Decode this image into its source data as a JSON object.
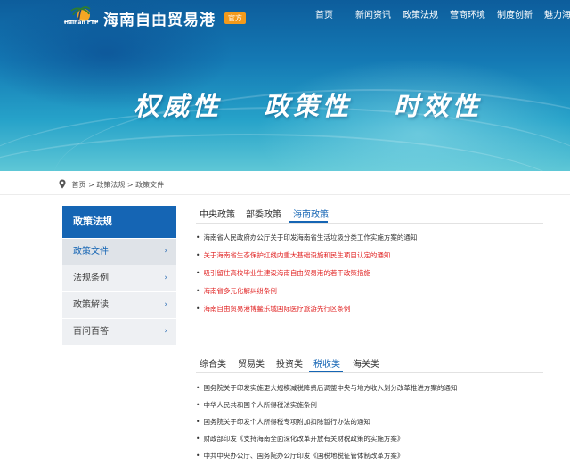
{
  "header": {
    "logo_text": "Hainan FTP",
    "site_title": "海南自由贸易港",
    "badge": "官方",
    "nav": [
      "首页",
      "新闻资讯",
      "政策法规",
      "营商环境",
      "制度创新",
      "魅力海南"
    ]
  },
  "hero": {
    "slogans": [
      "权威性",
      "政策性",
      "时效性"
    ]
  },
  "breadcrumb": [
    "首页",
    "政策法规",
    "政策文件"
  ],
  "breadcrumb_separator": ">",
  "sidebar": {
    "title": "政策法规",
    "items": [
      {
        "label": "政策文件",
        "active": true
      },
      {
        "label": "法规条例",
        "active": false
      },
      {
        "label": "政策解读",
        "active": false
      },
      {
        "label": "百问百答",
        "active": false
      }
    ]
  },
  "policy_tabs": {
    "tabs": [
      "中央政策",
      "部委政策",
      "海南政策"
    ],
    "active_index": 2,
    "items": [
      {
        "text": "海南省人民政府办公厅关于印发海南省生活垃圾分类工作实施方案的通知",
        "highlight": false
      },
      {
        "text": "关于海南省生态保护红线内重大基础设施和民生项目认定的通知",
        "highlight": true
      },
      {
        "text": "吸引留住高校毕业生建设海南自由贸易港的若干政策措施",
        "highlight": true
      },
      {
        "text": "海南省多元化解纠纷条例",
        "highlight": true
      },
      {
        "text": "海南自由贸易港博鳌乐城国际医疗旅游先行区条例",
        "highlight": true
      }
    ]
  },
  "category_tabs": {
    "tabs": [
      "综合类",
      "贸易类",
      "投资类",
      "税收类",
      "海关类"
    ],
    "active_index": 3,
    "items": [
      {
        "text": "国务院关于印发实施更大规模减税降费后调整中央与地方收入划分改革推进方案的通知",
        "highlight": false
      },
      {
        "text": "中华人民共和国个人所得税法实施条例",
        "highlight": false
      },
      {
        "text": "国务院关于印发个人所得税专项附加扣除暂行办法的通知",
        "highlight": false
      },
      {
        "text": "财政部印发《支持海南全面深化改革开放有关财税政策的实施方案》",
        "highlight": false
      },
      {
        "text": "中共中央办公厅、国务院办公厅印发《国税地税征管体制改革方案》",
        "highlight": false
      }
    ]
  },
  "colors": {
    "primary": "#1565b4",
    "highlight_red": "#e02020",
    "badge_orange": "#f29a1b",
    "sidebar_bg": "#eef0f3"
  }
}
